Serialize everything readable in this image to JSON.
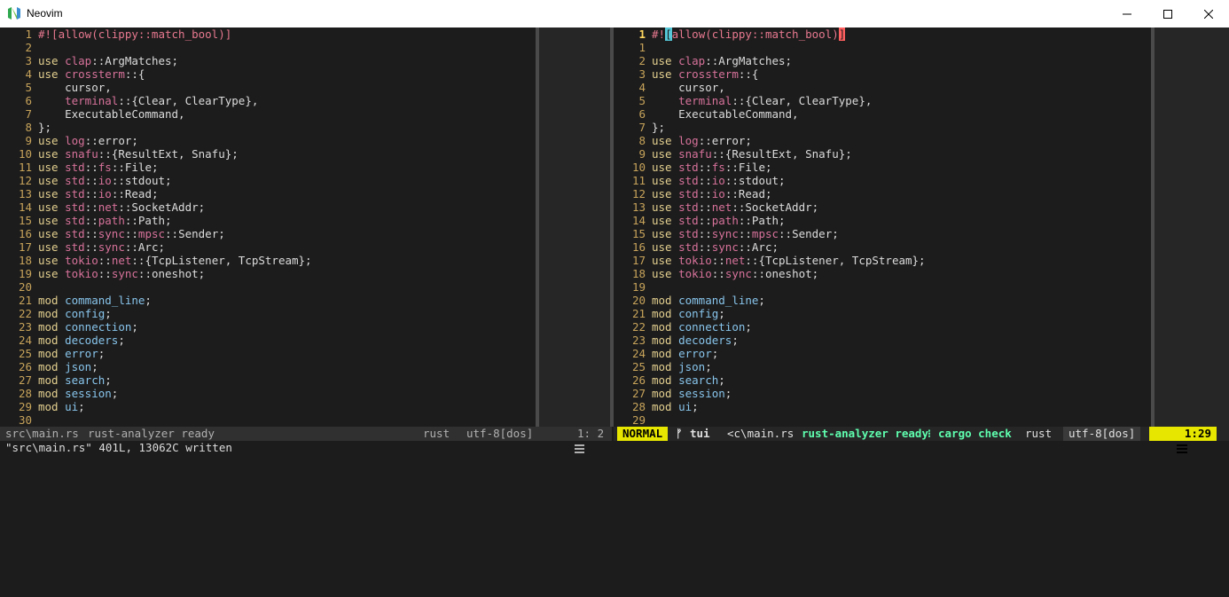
{
  "window": {
    "title": "Neovim",
    "brand_color": "#2fa84f"
  },
  "left_pane": {
    "lines": [
      {
        "n": "1",
        "tokens": [
          [
            "attr",
            "#![allow(clippy::match_bool)]"
          ]
        ]
      },
      {
        "n": "2",
        "tokens": []
      },
      {
        "n": "3",
        "tokens": [
          [
            "kw",
            "use "
          ],
          [
            "path",
            "clap"
          ],
          [
            "plain",
            "::ArgMatches;"
          ]
        ]
      },
      {
        "n": "4",
        "tokens": [
          [
            "kw",
            "use "
          ],
          [
            "path",
            "crossterm"
          ],
          [
            "plain",
            "::{"
          ]
        ]
      },
      {
        "n": "5",
        "tokens": [
          [
            "plain",
            "    cursor,"
          ]
        ]
      },
      {
        "n": "6",
        "tokens": [
          [
            "plain",
            "    "
          ],
          [
            "path",
            "terminal"
          ],
          [
            "plain",
            "::{Clear, ClearType},"
          ]
        ]
      },
      {
        "n": "7",
        "tokens": [
          [
            "plain",
            "    ExecutableCommand,"
          ]
        ]
      },
      {
        "n": "8",
        "tokens": [
          [
            "plain",
            "};"
          ]
        ]
      },
      {
        "n": "9",
        "tokens": [
          [
            "kw",
            "use "
          ],
          [
            "path",
            "log"
          ],
          [
            "plain",
            "::error;"
          ]
        ]
      },
      {
        "n": "10",
        "tokens": [
          [
            "kw",
            "use "
          ],
          [
            "path",
            "snafu"
          ],
          [
            "plain",
            "::{ResultExt, Snafu};"
          ]
        ]
      },
      {
        "n": "11",
        "tokens": [
          [
            "kw",
            "use "
          ],
          [
            "path",
            "std"
          ],
          [
            "plain",
            "::"
          ],
          [
            "path",
            "fs"
          ],
          [
            "plain",
            "::File;"
          ]
        ]
      },
      {
        "n": "12",
        "tokens": [
          [
            "kw",
            "use "
          ],
          [
            "path",
            "std"
          ],
          [
            "plain",
            "::"
          ],
          [
            "path",
            "io"
          ],
          [
            "plain",
            "::stdout;"
          ]
        ]
      },
      {
        "n": "13",
        "tokens": [
          [
            "kw",
            "use "
          ],
          [
            "path",
            "std"
          ],
          [
            "plain",
            "::"
          ],
          [
            "path",
            "io"
          ],
          [
            "plain",
            "::Read;"
          ]
        ]
      },
      {
        "n": "14",
        "tokens": [
          [
            "kw",
            "use "
          ],
          [
            "path",
            "std"
          ],
          [
            "plain",
            "::"
          ],
          [
            "path",
            "net"
          ],
          [
            "plain",
            "::SocketAddr;"
          ]
        ]
      },
      {
        "n": "15",
        "tokens": [
          [
            "kw",
            "use "
          ],
          [
            "path",
            "std"
          ],
          [
            "plain",
            "::"
          ],
          [
            "path",
            "path"
          ],
          [
            "plain",
            "::Path;"
          ]
        ]
      },
      {
        "n": "16",
        "tokens": [
          [
            "kw",
            "use "
          ],
          [
            "path",
            "std"
          ],
          [
            "plain",
            "::"
          ],
          [
            "path",
            "sync"
          ],
          [
            "plain",
            "::"
          ],
          [
            "path",
            "mpsc"
          ],
          [
            "plain",
            "::Sender;"
          ]
        ]
      },
      {
        "n": "17",
        "tokens": [
          [
            "kw",
            "use "
          ],
          [
            "path",
            "std"
          ],
          [
            "plain",
            "::"
          ],
          [
            "path",
            "sync"
          ],
          [
            "plain",
            "::Arc;"
          ]
        ]
      },
      {
        "n": "18",
        "tokens": [
          [
            "kw",
            "use "
          ],
          [
            "path",
            "tokio"
          ],
          [
            "plain",
            "::"
          ],
          [
            "path",
            "net"
          ],
          [
            "plain",
            "::{TcpListener, TcpStream};"
          ]
        ]
      },
      {
        "n": "19",
        "tokens": [
          [
            "kw",
            "use "
          ],
          [
            "path",
            "tokio"
          ],
          [
            "plain",
            "::"
          ],
          [
            "path",
            "sync"
          ],
          [
            "plain",
            "::oneshot;"
          ]
        ]
      },
      {
        "n": "20",
        "tokens": []
      },
      {
        "n": "21",
        "tokens": [
          [
            "kw",
            "mod "
          ],
          [
            "mod",
            "command_line"
          ],
          [
            "plain",
            ";"
          ]
        ]
      },
      {
        "n": "22",
        "tokens": [
          [
            "kw",
            "mod "
          ],
          [
            "mod",
            "config"
          ],
          [
            "plain",
            ";"
          ]
        ]
      },
      {
        "n": "23",
        "tokens": [
          [
            "kw",
            "mod "
          ],
          [
            "mod",
            "connection"
          ],
          [
            "plain",
            ";"
          ]
        ]
      },
      {
        "n": "24",
        "tokens": [
          [
            "kw",
            "mod "
          ],
          [
            "mod",
            "decoders"
          ],
          [
            "plain",
            ";"
          ]
        ]
      },
      {
        "n": "25",
        "tokens": [
          [
            "kw",
            "mod "
          ],
          [
            "mod",
            "error"
          ],
          [
            "plain",
            ";"
          ]
        ]
      },
      {
        "n": "26",
        "tokens": [
          [
            "kw",
            "mod "
          ],
          [
            "mod",
            "json"
          ],
          [
            "plain",
            ";"
          ]
        ]
      },
      {
        "n": "27",
        "tokens": [
          [
            "kw",
            "mod "
          ],
          [
            "mod",
            "search"
          ],
          [
            "plain",
            ";"
          ]
        ]
      },
      {
        "n": "28",
        "tokens": [
          [
            "kw",
            "mod "
          ],
          [
            "mod",
            "session"
          ],
          [
            "plain",
            ";"
          ]
        ]
      },
      {
        "n": "29",
        "tokens": [
          [
            "kw",
            "mod "
          ],
          [
            "mod",
            "ui"
          ],
          [
            "plain",
            ";"
          ]
        ]
      },
      {
        "n": "30",
        "tokens": []
      }
    ]
  },
  "right_pane": {
    "lines": [
      {
        "n": "1",
        "cur": true,
        "tokens": [
          [
            "attr",
            "#!"
          ],
          [
            "bracket",
            "["
          ],
          [
            "attr",
            "allow(clippy::match_bool)"
          ],
          [
            "cursor",
            "]"
          ]
        ]
      },
      {
        "n": "1",
        "tokens": []
      },
      {
        "n": "2",
        "tokens": [
          [
            "kw",
            "use "
          ],
          [
            "path",
            "clap"
          ],
          [
            "plain",
            "::ArgMatches;"
          ]
        ]
      },
      {
        "n": "3",
        "tokens": [
          [
            "kw",
            "use "
          ],
          [
            "path",
            "crossterm"
          ],
          [
            "plain",
            "::{"
          ]
        ]
      },
      {
        "n": "4",
        "tokens": [
          [
            "plain",
            "    cursor,"
          ]
        ]
      },
      {
        "n": "5",
        "tokens": [
          [
            "plain",
            "    "
          ],
          [
            "path",
            "terminal"
          ],
          [
            "plain",
            "::{Clear, ClearType},"
          ]
        ]
      },
      {
        "n": "6",
        "tokens": [
          [
            "plain",
            "    ExecutableCommand,"
          ]
        ]
      },
      {
        "n": "7",
        "tokens": [
          [
            "plain",
            "};"
          ]
        ]
      },
      {
        "n": "8",
        "tokens": [
          [
            "kw",
            "use "
          ],
          [
            "path",
            "log"
          ],
          [
            "plain",
            "::error;"
          ]
        ]
      },
      {
        "n": "9",
        "tokens": [
          [
            "kw",
            "use "
          ],
          [
            "path",
            "snafu"
          ],
          [
            "plain",
            "::{ResultExt, Snafu};"
          ]
        ]
      },
      {
        "n": "10",
        "tokens": [
          [
            "kw",
            "use "
          ],
          [
            "path",
            "std"
          ],
          [
            "plain",
            "::"
          ],
          [
            "path",
            "fs"
          ],
          [
            "plain",
            "::File;"
          ]
        ]
      },
      {
        "n": "11",
        "tokens": [
          [
            "kw",
            "use "
          ],
          [
            "path",
            "std"
          ],
          [
            "plain",
            "::"
          ],
          [
            "path",
            "io"
          ],
          [
            "plain",
            "::stdout;"
          ]
        ]
      },
      {
        "n": "12",
        "tokens": [
          [
            "kw",
            "use "
          ],
          [
            "path",
            "std"
          ],
          [
            "plain",
            "::"
          ],
          [
            "path",
            "io"
          ],
          [
            "plain",
            "::Read;"
          ]
        ]
      },
      {
        "n": "13",
        "tokens": [
          [
            "kw",
            "use "
          ],
          [
            "path",
            "std"
          ],
          [
            "plain",
            "::"
          ],
          [
            "path",
            "net"
          ],
          [
            "plain",
            "::SocketAddr;"
          ]
        ]
      },
      {
        "n": "14",
        "tokens": [
          [
            "kw",
            "use "
          ],
          [
            "path",
            "std"
          ],
          [
            "plain",
            "::"
          ],
          [
            "path",
            "path"
          ],
          [
            "plain",
            "::Path;"
          ]
        ]
      },
      {
        "n": "15",
        "tokens": [
          [
            "kw",
            "use "
          ],
          [
            "path",
            "std"
          ],
          [
            "plain",
            "::"
          ],
          [
            "path",
            "sync"
          ],
          [
            "plain",
            "::"
          ],
          [
            "path",
            "mpsc"
          ],
          [
            "plain",
            "::Sender;"
          ]
        ]
      },
      {
        "n": "16",
        "tokens": [
          [
            "kw",
            "use "
          ],
          [
            "path",
            "std"
          ],
          [
            "plain",
            "::"
          ],
          [
            "path",
            "sync"
          ],
          [
            "plain",
            "::Arc;"
          ]
        ]
      },
      {
        "n": "17",
        "tokens": [
          [
            "kw",
            "use "
          ],
          [
            "path",
            "tokio"
          ],
          [
            "plain",
            "::"
          ],
          [
            "path",
            "net"
          ],
          [
            "plain",
            "::{TcpListener, TcpStream};"
          ]
        ]
      },
      {
        "n": "18",
        "tokens": [
          [
            "kw",
            "use "
          ],
          [
            "path",
            "tokio"
          ],
          [
            "plain",
            "::"
          ],
          [
            "path",
            "sync"
          ],
          [
            "plain",
            "::oneshot;"
          ]
        ]
      },
      {
        "n": "19",
        "tokens": []
      },
      {
        "n": "20",
        "tokens": [
          [
            "kw",
            "mod "
          ],
          [
            "mod",
            "command_line"
          ],
          [
            "plain",
            ";"
          ]
        ]
      },
      {
        "n": "21",
        "tokens": [
          [
            "kw",
            "mod "
          ],
          [
            "mod",
            "config"
          ],
          [
            "plain",
            ";"
          ]
        ]
      },
      {
        "n": "22",
        "tokens": [
          [
            "kw",
            "mod "
          ],
          [
            "mod",
            "connection"
          ],
          [
            "plain",
            ";"
          ]
        ]
      },
      {
        "n": "23",
        "tokens": [
          [
            "kw",
            "mod "
          ],
          [
            "mod",
            "decoders"
          ],
          [
            "plain",
            ";"
          ]
        ]
      },
      {
        "n": "24",
        "tokens": [
          [
            "kw",
            "mod "
          ],
          [
            "mod",
            "error"
          ],
          [
            "plain",
            ";"
          ]
        ]
      },
      {
        "n": "25",
        "tokens": [
          [
            "kw",
            "mod "
          ],
          [
            "mod",
            "json"
          ],
          [
            "plain",
            ";"
          ]
        ]
      },
      {
        "n": "26",
        "tokens": [
          [
            "kw",
            "mod "
          ],
          [
            "mod",
            "search"
          ],
          [
            "plain",
            ";"
          ]
        ]
      },
      {
        "n": "27",
        "tokens": [
          [
            "kw",
            "mod "
          ],
          [
            "mod",
            "session"
          ],
          [
            "plain",
            ";"
          ]
        ]
      },
      {
        "n": "28",
        "tokens": [
          [
            "kw",
            "mod "
          ],
          [
            "mod",
            "ui"
          ],
          [
            "plain",
            ";"
          ]
        ]
      },
      {
        "n": "29",
        "tokens": []
      }
    ]
  },
  "status_left": {
    "file": "src\\main.rs",
    "lsp": "rust-analyzer ready",
    "filetype": "rust",
    "encoding": "utf-8[dos]",
    "position": "1: 2"
  },
  "status_right": {
    "mode": "NORMAL",
    "branch": "tui",
    "file": "<c\\main.rs",
    "lsp": "rust-analyzer ready",
    "separator": "⁝",
    "check": "cargo check",
    "filetype": "rust",
    "encoding": "utf-8[dos]",
    "position": "1:29"
  },
  "cmdline": {
    "text": "\"src\\main.rs\" 401L, 13062C written"
  },
  "colors": {
    "mode_bg": "#e6e600",
    "status_active_text": "#5fffaf",
    "status_inactive_bg": "#303030"
  }
}
